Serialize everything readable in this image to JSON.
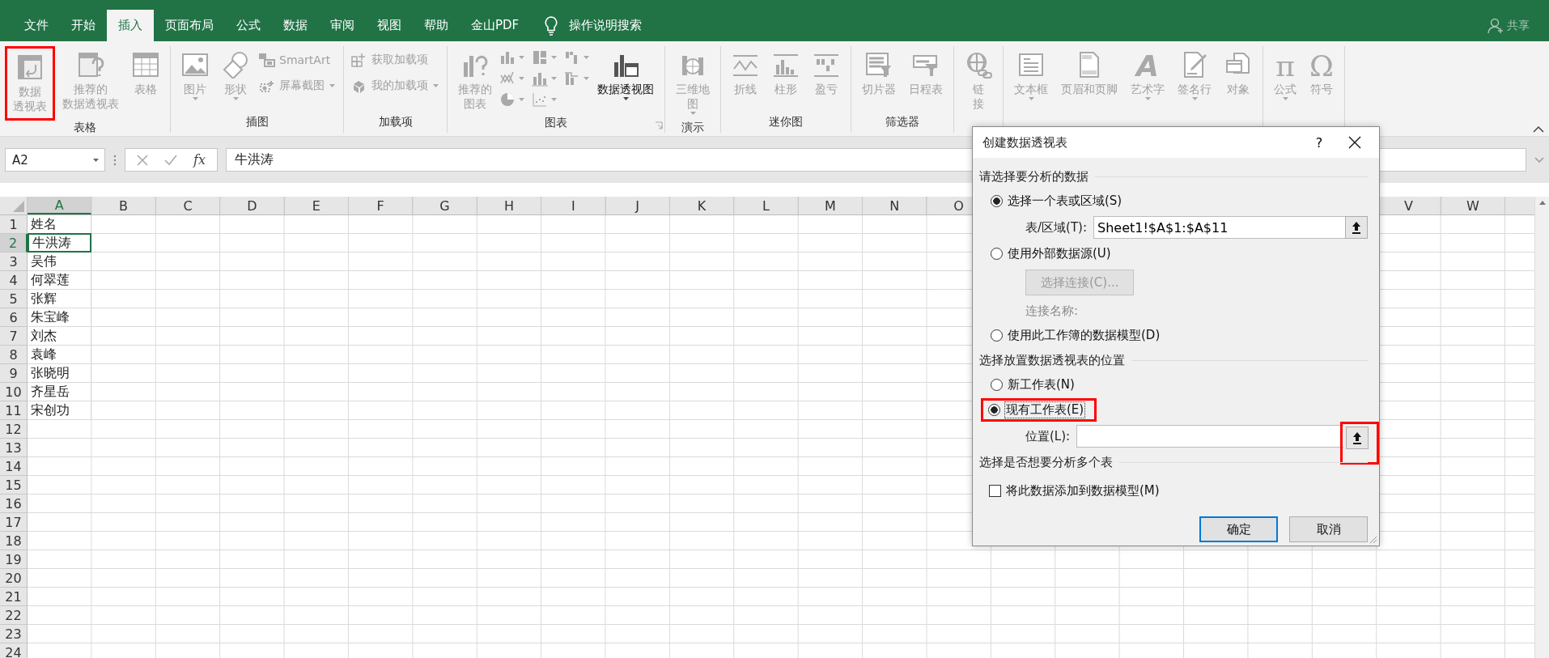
{
  "tabs": [
    {
      "label": "文件",
      "selected": false
    },
    {
      "label": "开始",
      "selected": false
    },
    {
      "label": "插入",
      "selected": true
    },
    {
      "label": "页面布局",
      "selected": false
    },
    {
      "label": "公式",
      "selected": false
    },
    {
      "label": "数据",
      "selected": false
    },
    {
      "label": "审阅",
      "selected": false
    },
    {
      "label": "视图",
      "selected": false
    },
    {
      "label": "帮助",
      "selected": false
    },
    {
      "label": "金山PDF",
      "selected": false
    }
  ],
  "tell_me": "操作说明搜索",
  "share": "共享",
  "ribbon_groups": [
    {
      "label": "表格",
      "items": [
        {
          "kind": "large",
          "lines": [
            "数据",
            "透视表"
          ],
          "disabled": true,
          "highlighted": true
        },
        {
          "kind": "large",
          "lines": [
            "推荐的",
            "数据透视表"
          ],
          "disabled": true,
          "highlighted": false
        },
        {
          "kind": "large",
          "lines": [
            "表格"
          ],
          "disabled": true,
          "highlighted": false
        }
      ]
    },
    {
      "label": "插图",
      "items": [
        {
          "kind": "large",
          "lines": [
            "图片"
          ],
          "dropdown": true,
          "disabled": true
        },
        {
          "kind": "large",
          "lines": [
            "形状"
          ],
          "dropdown": true,
          "disabled": true
        },
        {
          "kind": "stack",
          "disabled": true,
          "entries": [
            {
              "label": "SmartArt",
              "dropdown": false
            },
            {
              "label": "屏幕截图",
              "dropdown": true
            }
          ]
        }
      ]
    },
    {
      "label": "加载项",
      "items": [
        {
          "kind": "stack",
          "disabled": true,
          "entries": [
            {
              "label": "获取加载项",
              "dropdown": false
            },
            {
              "label": "我的加载项",
              "dropdown": true
            }
          ]
        }
      ]
    },
    {
      "label": "图表",
      "launcher": true,
      "items": [
        {
          "kind": "large",
          "lines": [
            "推荐的",
            "图表"
          ],
          "disabled": true
        },
        {
          "kind": "chart-icons",
          "disabled": true
        },
        {
          "kind": "large",
          "lines": [
            "数据透视图"
          ],
          "dropdown": true,
          "disabled": false
        }
      ]
    },
    {
      "label": "演示",
      "items": [
        {
          "kind": "large",
          "lines": [
            "三维地",
            "图"
          ],
          "dropdown": true,
          "disabled": true
        }
      ]
    },
    {
      "label": "迷你图",
      "items": [
        {
          "kind": "large",
          "lines": [
            "折线"
          ],
          "disabled": true
        },
        {
          "kind": "large",
          "lines": [
            "柱形"
          ],
          "disabled": true
        },
        {
          "kind": "large",
          "lines": [
            "盈亏"
          ],
          "disabled": true
        }
      ]
    },
    {
      "label": "筛选器",
      "items": [
        {
          "kind": "large",
          "lines": [
            "切片器"
          ],
          "disabled": true
        },
        {
          "kind": "large",
          "lines": [
            "日程表"
          ],
          "disabled": true
        }
      ]
    },
    {
      "items": [
        {
          "kind": "large",
          "lines": [
            "链",
            "接"
          ],
          "disabled": true
        }
      ]
    },
    {
      "items": [
        {
          "kind": "large",
          "lines": [
            "文本框"
          ],
          "dropdown": true,
          "disabled": true
        },
        {
          "kind": "large",
          "lines": [
            "页眉和页脚"
          ],
          "disabled": true
        },
        {
          "kind": "large",
          "lines": [
            "艺术字"
          ],
          "dropdown": true,
          "disabled": true,
          "icon_char": "A"
        },
        {
          "kind": "large",
          "lines": [
            "签名行"
          ],
          "dropdown": true,
          "disabled": true
        },
        {
          "kind": "large",
          "lines": [
            "对象"
          ],
          "disabled": true
        }
      ]
    },
    {
      "items": [
        {
          "kind": "large",
          "lines": [
            "公式"
          ],
          "dropdown": true,
          "disabled": true,
          "icon_char": "π"
        },
        {
          "kind": "large",
          "lines": [
            "符号"
          ],
          "disabled": true,
          "icon_char": "Ω"
        }
      ]
    }
  ],
  "formula_bar": {
    "name_box": "A2",
    "function_label": "fx",
    "formula": "牛洪涛"
  },
  "sheet": {
    "columns_left": [
      {
        "label": "A",
        "selected": true
      },
      {
        "label": "B",
        "selected": false
      },
      {
        "label": "C",
        "selected": false
      },
      {
        "label": "D",
        "selected": false
      },
      {
        "label": "E",
        "selected": false
      },
      {
        "label": "F",
        "selected": false
      },
      {
        "label": "G",
        "selected": false
      },
      {
        "label": "H",
        "selected": false
      },
      {
        "label": "I",
        "selected": false
      },
      {
        "label": "J",
        "selected": false
      },
      {
        "label": "K",
        "selected": false
      },
      {
        "label": "L",
        "selected": false
      },
      {
        "label": "M",
        "selected": false
      },
      {
        "label": "N",
        "selected": false
      },
      {
        "label": "O",
        "selected": false
      }
    ],
    "columns_right": [
      {
        "label": "V",
        "selected": false
      },
      {
        "label": "W",
        "selected": false
      }
    ],
    "rows": [
      {
        "number": "1",
        "selected": false,
        "cells": [
          {
            "text": "姓名",
            "active": false
          }
        ]
      },
      {
        "number": "2",
        "selected": true,
        "cells": [
          {
            "text": "牛洪涛",
            "active": true
          }
        ]
      },
      {
        "number": "3",
        "selected": false,
        "cells": [
          {
            "text": "吴伟",
            "active": false
          }
        ]
      },
      {
        "number": "4",
        "selected": false,
        "cells": [
          {
            "text": "何翠莲",
            "active": false
          }
        ]
      },
      {
        "number": "5",
        "selected": false,
        "cells": [
          {
            "text": "张辉",
            "active": false
          }
        ]
      },
      {
        "number": "6",
        "selected": false,
        "cells": [
          {
            "text": "朱宝峰",
            "active": false
          }
        ]
      },
      {
        "number": "7",
        "selected": false,
        "cells": [
          {
            "text": "刘杰",
            "active": false
          }
        ]
      },
      {
        "number": "8",
        "selected": false,
        "cells": [
          {
            "text": "袁峰",
            "active": false
          }
        ]
      },
      {
        "number": "9",
        "selected": false,
        "cells": [
          {
            "text": "张晓明",
            "active": false
          }
        ]
      },
      {
        "number": "10",
        "selected": false,
        "cells": [
          {
            "text": "齐星岳",
            "active": false
          }
        ]
      },
      {
        "number": "11",
        "selected": false,
        "cells": [
          {
            "text": "宋创功",
            "active": false
          }
        ]
      },
      {
        "number": "12",
        "selected": false
      },
      {
        "number": "13",
        "selected": false
      },
      {
        "number": "14",
        "selected": false
      },
      {
        "number": "15",
        "selected": false
      },
      {
        "number": "16",
        "selected": false
      },
      {
        "number": "17",
        "selected": false
      },
      {
        "number": "18",
        "selected": false
      },
      {
        "number": "19",
        "selected": false
      },
      {
        "number": "20",
        "selected": false
      },
      {
        "number": "21",
        "selected": false
      },
      {
        "number": "22",
        "selected": false
      },
      {
        "number": "23",
        "selected": false
      },
      {
        "number": "24",
        "selected": false
      }
    ]
  },
  "dialog": {
    "title": "创建数据透视表",
    "help": "?",
    "sections": [
      {
        "heading": "请选择要分析的数据",
        "rows": [
          {
            "kind": "radio",
            "label": "选择一个表或区域(S)",
            "selected": true,
            "focused": false,
            "highlighted": false
          },
          {
            "kind": "field",
            "label": "表/区域(T):",
            "value": "Sheet1!$A$1:$A$11",
            "highlighted": false
          },
          {
            "kind": "radio",
            "label": "使用外部数据源(U)",
            "selected": false,
            "focused": false,
            "highlighted": false
          },
          {
            "kind": "button",
            "label": "选择连接(C)...",
            "disabled": true
          },
          {
            "kind": "note",
            "label": "连接名称:",
            "disabled": true
          },
          {
            "kind": "radio",
            "label": "使用此工作簿的数据模型(D)",
            "selected": false,
            "focused": false,
            "highlighted": false
          }
        ]
      },
      {
        "heading": "选择放置数据透视表的位置",
        "rows": [
          {
            "kind": "radio",
            "label": "新工作表(N)",
            "selected": false,
            "focused": false,
            "highlighted": false
          },
          {
            "kind": "radio",
            "label": "现有工作表(E)",
            "selected": true,
            "focused": true,
            "highlighted": true
          },
          {
            "kind": "field",
            "label": "位置(L):",
            "highlighted": true
          }
        ]
      },
      {
        "heading": "选择是否想要分析多个表",
        "rows": [
          {
            "kind": "checkbox",
            "label": "将此数据添加到数据模型(M)",
            "checked": false
          }
        ]
      }
    ],
    "buttons": [
      {
        "label": "确定",
        "default": true
      },
      {
        "label": "取消",
        "default": false
      }
    ]
  }
}
